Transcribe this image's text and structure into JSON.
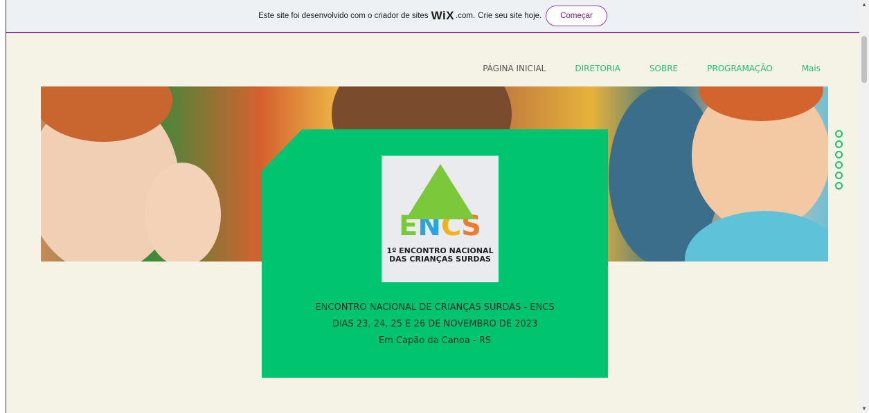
{
  "wix_banner": {
    "text_before": "Este site foi desenvolvido com o criador de sites",
    "logo": "WiX",
    "dotcom": ".com.",
    "text_after": "Crie seu site hoje.",
    "cta_label": "Começar"
  },
  "nav": {
    "items": [
      {
        "label": "PÁGINA INICIAL",
        "active": true
      },
      {
        "label": "DIRETORIA"
      },
      {
        "label": "SOBRE"
      },
      {
        "label": "PROGRAMAÇÃO"
      },
      {
        "label": "Mais"
      }
    ]
  },
  "logo": {
    "letters": [
      "E",
      "N",
      "C",
      "S"
    ],
    "caption_line1": "1º ENCONTRO NACIONAL",
    "caption_line2": "DAS CRIANÇAS SURDAS"
  },
  "card": {
    "line1": "ENCONTRO NACIONAL DE CRIANÇAS SURDAS - ENCS",
    "line2": "DIAS 23, 24, 25 E 26 DE NOVEMBRO DE 2023",
    "line3": "Em Capão da Canoa - RS"
  },
  "colors": {
    "accent_green": "#00c46f",
    "nav_green": "#1fbf72",
    "wix_purple": "#8e3a9d",
    "page_bg": "#f4f3e6"
  },
  "slideshow": {
    "dot_count": 6
  }
}
